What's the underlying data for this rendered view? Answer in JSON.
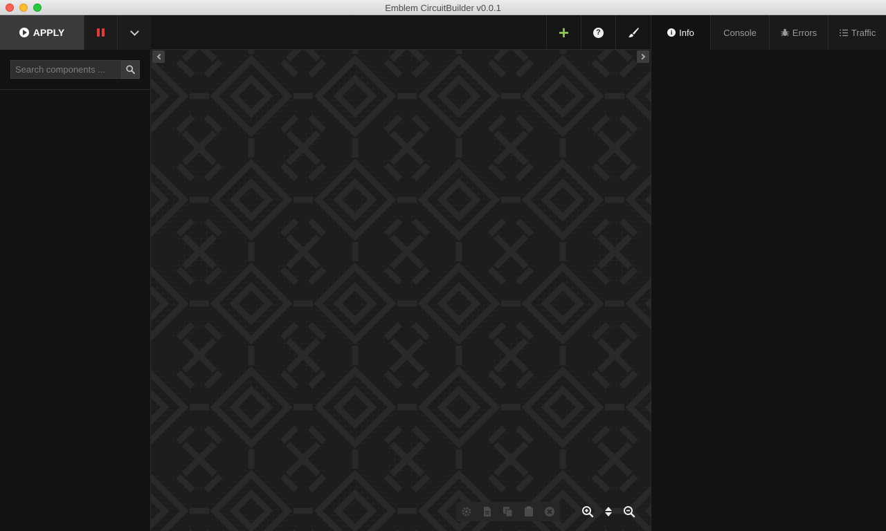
{
  "window": {
    "title": "Emblem CircuitBuilder v0.0.1"
  },
  "toolbar": {
    "apply_label": "APPLY",
    "pause_icon": "pause-icon",
    "menu_icon": "chevron-down-icon",
    "add_icon": "plus-icon",
    "help_icon": "help-icon",
    "brush_icon": "paintbrush-icon"
  },
  "search": {
    "placeholder": "Search components ...",
    "value": "",
    "icon": "search-icon"
  },
  "canvas": {
    "nav_left_icon": "chevron-left-icon",
    "nav_right_icon": "chevron-right-icon",
    "edit_tools": [
      "gear-icon",
      "file-icon",
      "copy-icon",
      "paste-icon",
      "delete-icon"
    ],
    "zoom_tools": [
      "zoom-in-icon",
      "fit-vertical-icon",
      "zoom-out-icon"
    ]
  },
  "right_panel": {
    "tabs": [
      {
        "label": "Info",
        "icon": "info-icon",
        "active": true
      },
      {
        "label": "Console",
        "icon": "",
        "active": false
      },
      {
        "label": "Errors",
        "icon": "bug-icon",
        "active": false
      },
      {
        "label": "Traffic",
        "icon": "list-icon",
        "active": false
      }
    ]
  },
  "colors": {
    "pause": "#e53935",
    "add": "#8bc34a",
    "window_bg": "#121212",
    "canvas_bg": "#1c1c1e"
  }
}
